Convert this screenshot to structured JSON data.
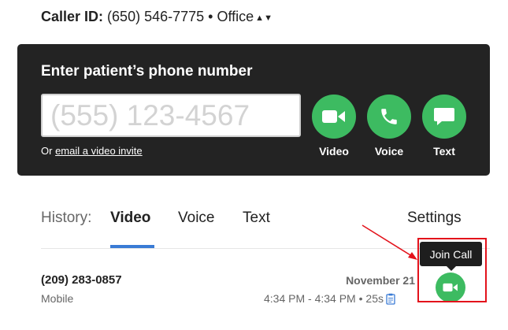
{
  "caller": {
    "label": "Caller ID:",
    "number": "(650) 546-7775",
    "separator": "•",
    "location": "Office",
    "selector_glyph": "▴▾"
  },
  "panel": {
    "title": "Enter patient’s phone number",
    "phone_placeholder": "(555) 123-4567",
    "phone_value": "",
    "invite_prefix": "Or",
    "invite_link": "email a video invite",
    "actions": [
      {
        "label": "Video",
        "icon": "video-camera-icon"
      },
      {
        "label": "Voice",
        "icon": "phone-handset-icon"
      },
      {
        "label": "Text",
        "icon": "chat-bubble-icon"
      }
    ]
  },
  "history": {
    "label": "History:",
    "tabs": [
      "Video",
      "Voice",
      "Text"
    ],
    "active_tab": "Video",
    "settings": "Settings"
  },
  "calls": [
    {
      "number": "(209) 283-0857",
      "type": "Mobile",
      "date": "November 21",
      "time_range": "4:34 PM - 4:34 PM",
      "separator": "•",
      "duration": "25s",
      "notes_icon": "clipboard-icon",
      "join_tooltip": "Join Call"
    }
  ],
  "colors": {
    "accent_green": "#3dbb61",
    "panel_bg": "#232323",
    "tab_underline": "#3a7bd5",
    "annotation_red": "#e3121b"
  }
}
